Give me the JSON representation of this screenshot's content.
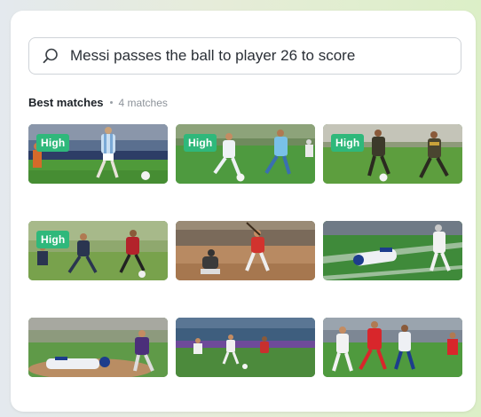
{
  "search": {
    "query": "Messi passes the ball to player 26 to score"
  },
  "results": {
    "title": "Best matches",
    "count_label": "4 matches",
    "items": [
      {
        "badge": "High",
        "scene": "soccer-stadium"
      },
      {
        "badge": "High",
        "scene": "soccer-field"
      },
      {
        "badge": "High",
        "scene": "soccer-dark-kits"
      },
      {
        "badge": "High",
        "scene": "soccer-youth"
      },
      {
        "badge": "",
        "scene": "baseball-batter"
      },
      {
        "badge": "",
        "scene": "football-dive"
      },
      {
        "badge": "",
        "scene": "baseball-slide"
      },
      {
        "badge": "",
        "scene": "soccer-stadium-wide"
      },
      {
        "badge": "",
        "scene": "soccer-red-white"
      }
    ]
  },
  "colors": {
    "badge": "#2fb87b",
    "grass": "#3b7a2c"
  },
  "icons": {
    "search": "search-icon"
  }
}
